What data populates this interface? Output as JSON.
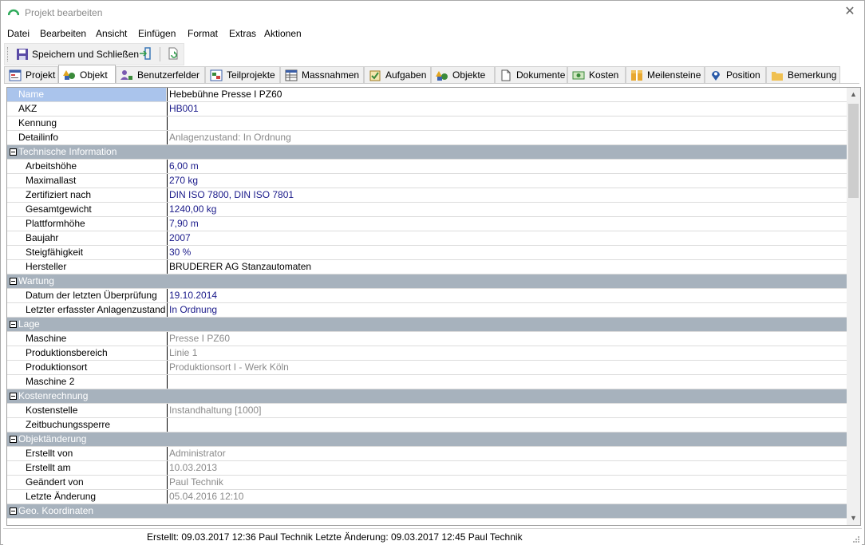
{
  "window": {
    "title": "Projekt bearbeiten",
    "close_glyph": "✕"
  },
  "menu": [
    "Datei",
    "Bearbeiten",
    "Ansicht",
    "Einfügen",
    "Format",
    "Extras",
    "Aktionen"
  ],
  "toolbar": {
    "save_label": "Speichern und Schließen"
  },
  "tabs": [
    "Projekt",
    "Objekt",
    "Benutzerfelder",
    "Teilprojekte",
    "Massnahmen",
    "Aufgaben",
    "Objekte",
    "Dokumente",
    "Kosten",
    "Meilensteine",
    "Position",
    "Bemerkung"
  ],
  "active_tab": "Objekt",
  "grid": {
    "rows": [
      {
        "kind": "field",
        "label": "Name",
        "value": "Hebebühne Presse I PZ60",
        "style": "black",
        "selected": true
      },
      {
        "kind": "field",
        "label": "AKZ",
        "value": "HB001",
        "style": "blue"
      },
      {
        "kind": "field",
        "label": "Kennung",
        "value": "",
        "style": "black"
      },
      {
        "kind": "field",
        "label": "Detailinfo",
        "value": "Anlagenzustand: In Ordnung",
        "style": "gray"
      },
      {
        "kind": "category",
        "label": "Technische Information"
      },
      {
        "kind": "sub",
        "label": "Arbeitshöhe",
        "value": "6,00 m",
        "style": "blue"
      },
      {
        "kind": "sub",
        "label": "Maximallast",
        "value": "270 kg",
        "style": "blue"
      },
      {
        "kind": "sub",
        "label": "Zertifiziert nach",
        "value": "DIN ISO 7800, DIN ISO 7801",
        "style": "blue"
      },
      {
        "kind": "sub",
        "label": "Gesamtgewicht",
        "value": "1240,00 kg",
        "style": "blue"
      },
      {
        "kind": "sub",
        "label": "Plattformhöhe",
        "value": "7,90 m",
        "style": "blue"
      },
      {
        "kind": "sub",
        "label": "Baujahr",
        "value": "2007",
        "style": "blue"
      },
      {
        "kind": "sub",
        "label": "Steigfähigkeit",
        "value": "30 %",
        "style": "blue"
      },
      {
        "kind": "sub",
        "label": "Hersteller",
        "value": "BRUDERER AG Stanzautomaten",
        "style": "black"
      },
      {
        "kind": "category",
        "label": "Wartung"
      },
      {
        "kind": "sub",
        "label": "Datum der letzten Überprüfung",
        "value": "19.10.2014",
        "style": "blue"
      },
      {
        "kind": "sub",
        "label": "Letzter erfasster Anlagenzustand",
        "value": "In Ordnung",
        "style": "blue"
      },
      {
        "kind": "category",
        "label": "Lage"
      },
      {
        "kind": "sub",
        "label": "Maschine",
        "value": "Presse I PZ60",
        "style": "gray"
      },
      {
        "kind": "sub",
        "label": "Produktionsbereich",
        "value": "Linie 1",
        "style": "gray"
      },
      {
        "kind": "sub",
        "label": "Produktionsort",
        "value": "Produktionsort I - Werk Köln",
        "style": "gray"
      },
      {
        "kind": "sub",
        "label": "Maschine 2",
        "value": "",
        "style": "black"
      },
      {
        "kind": "category",
        "label": "Kostenrechnung"
      },
      {
        "kind": "sub",
        "label": "Kostenstelle",
        "value": "Instandhaltung [1000]",
        "style": "gray"
      },
      {
        "kind": "sub",
        "label": "Zeitbuchungssperre",
        "value": "",
        "style": "black"
      },
      {
        "kind": "category",
        "label": "Objektänderung"
      },
      {
        "kind": "sub",
        "label": "Erstellt von",
        "value": "Administrator",
        "style": "gray"
      },
      {
        "kind": "sub",
        "label": "Erstellt am",
        "value": "10.03.2013",
        "style": "gray"
      },
      {
        "kind": "sub",
        "label": "Geändert von",
        "value": "Paul Technik",
        "style": "gray"
      },
      {
        "kind": "sub",
        "label": "Letzte Änderung",
        "value": "05.04.2016 12:10",
        "style": "gray"
      },
      {
        "kind": "category",
        "label": "Geo. Koordinaten"
      }
    ]
  },
  "status": {
    "text": "Erstellt: 09.03.2017 12:36 Paul Technik  Letzte Änderung: 09.03.2017 12:45 Paul Technik"
  },
  "colors": {
    "category_bg": "#a7b2bd",
    "selection_bg": "#aac4ec",
    "value_blue": "#1a1a8a",
    "value_gray": "#8a8a8a"
  }
}
